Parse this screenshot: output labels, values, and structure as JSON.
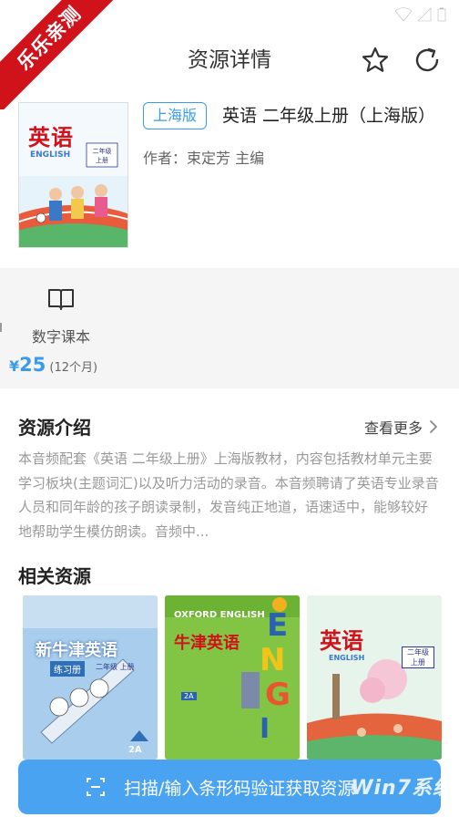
{
  "ribbon": {
    "text": "乐乐亲测"
  },
  "header": {
    "title": "资源详情"
  },
  "book": {
    "tag": "上海版",
    "title": "英语 二年级上册（上海版）",
    "author": "作者：束定芳 主编",
    "cover_text": "英语",
    "cover_grade": "二年级\n上册",
    "cover_en": "ENGLISH"
  },
  "ebook": {
    "label": "数字课本"
  },
  "price": {
    "symbol": "¥",
    "value": "25",
    "period": "(12个月)"
  },
  "intro": {
    "title": "资源介绍",
    "more": "查看更多",
    "text": "本音频配套《英语 二年级上册》上海版教材，内容包括教材单元主要学习板块(主题词汇)以及听力活动的录音。本音频聘请了英语专业录音人员和同年龄的孩子朗读录制，发音纯正地道，语速适中，能够较好地帮助学生模仿朗读。音频中..."
  },
  "related": {
    "title": "相关资源",
    "items": [
      {
        "title": "新牛津英语",
        "subtitle": "练习册",
        "grade": "二年级 上册",
        "level": "2A",
        "color": "#9cc4e8"
      },
      {
        "title": "牛津英语",
        "subtitle": "OXFORD ENGLISH",
        "level": "2A",
        "color": "#7cc23a"
      },
      {
        "title": "英语",
        "subtitle": "ENGLISH",
        "grade": "二年级\n上册",
        "color": "#dff0e8"
      }
    ]
  },
  "scan_button": {
    "label": "扫描/输入条形码验证获取资源"
  },
  "watermark": {
    "text": "Win7系统"
  },
  "colors": {
    "accent": "#3a9bee",
    "button": "#4aa3f0",
    "ribbon": "#d0121b"
  }
}
